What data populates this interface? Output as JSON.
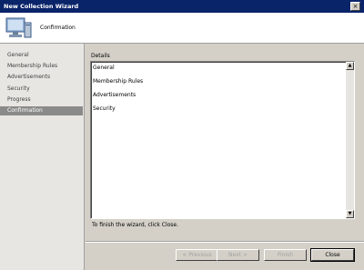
{
  "window": {
    "title": "New Collection Wizard",
    "close_glyph": "×"
  },
  "banner": {
    "title": "Confirmation",
    "icon": "computer-collection-icon"
  },
  "sidebar": {
    "items": [
      {
        "label": "General"
      },
      {
        "label": "Membership Rules"
      },
      {
        "label": "Advertisements"
      },
      {
        "label": "Security"
      },
      {
        "label": "Progress"
      },
      {
        "label": "Confirmation",
        "active": true
      }
    ]
  },
  "details": {
    "label": "Details",
    "lines": [
      "General",
      "Membership Rules",
      "Advertisements",
      "Security"
    ],
    "scroll_up": "▲",
    "scroll_down": "▼"
  },
  "finish_text": "To finish the wizard, click Close.",
  "buttons": {
    "previous": "< Previous",
    "next": "Next >",
    "finish": "Finish",
    "close": "Close"
  },
  "colors": {
    "titlebar": "#0a246a",
    "window_bg": "#d4d0c8",
    "active_nav": "#8a8a8a"
  }
}
